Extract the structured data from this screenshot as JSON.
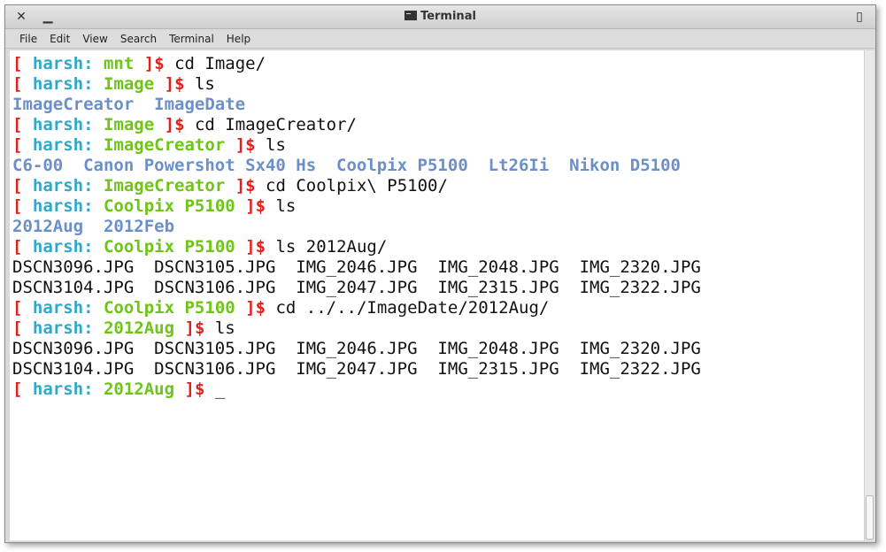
{
  "window": {
    "title": "Terminal",
    "controls": {
      "close": "✕",
      "minimize": "▁",
      "restore": "▯"
    }
  },
  "menu": [
    "File",
    "Edit",
    "View",
    "Search",
    "Terminal",
    "Help"
  ],
  "colors": {
    "bracket": "#e0211d",
    "user": "#31a8c9",
    "cwd": "#6ec417",
    "dir_listing": "#6b8fc9",
    "text": "#111111"
  },
  "terminal": {
    "lines": [
      {
        "type": "prompt",
        "user": "harsh",
        "cwd": "mnt",
        "cmd": "cd Image/"
      },
      {
        "type": "prompt",
        "user": "harsh",
        "cwd": "Image",
        "cmd": "ls"
      },
      {
        "type": "dirs",
        "text": "ImageCreator  ImageDate"
      },
      {
        "type": "prompt",
        "user": "harsh",
        "cwd": "Image",
        "cmd": "cd ImageCreator/"
      },
      {
        "type": "prompt",
        "user": "harsh",
        "cwd": "ImageCreator",
        "cmd": "ls"
      },
      {
        "type": "dirs",
        "text": "C6-00  Canon Powershot Sx40 Hs  Coolpix P5100  Lt26Ii  Nikon D5100"
      },
      {
        "type": "prompt",
        "user": "harsh",
        "cwd": "ImageCreator",
        "cmd": "cd Coolpix\\ P5100/"
      },
      {
        "type": "prompt",
        "user": "harsh",
        "cwd": "Coolpix P5100",
        "cmd": "ls"
      },
      {
        "type": "dirs",
        "text": "2012Aug  2012Feb"
      },
      {
        "type": "prompt",
        "user": "harsh",
        "cwd": "Coolpix P5100",
        "cmd": "ls 2012Aug/"
      },
      {
        "type": "out",
        "text": "DSCN3096.JPG  DSCN3105.JPG  IMG_2046.JPG  IMG_2048.JPG  IMG_2320.JPG"
      },
      {
        "type": "out",
        "text": "DSCN3104.JPG  DSCN3106.JPG  IMG_2047.JPG  IMG_2315.JPG  IMG_2322.JPG"
      },
      {
        "type": "prompt",
        "user": "harsh",
        "cwd": "Coolpix P5100",
        "cmd": "cd ../../ImageDate/2012Aug/"
      },
      {
        "type": "prompt",
        "user": "harsh",
        "cwd": "2012Aug",
        "cmd": "ls"
      },
      {
        "type": "out",
        "text": "DSCN3096.JPG  DSCN3105.JPG  IMG_2046.JPG  IMG_2048.JPG  IMG_2320.JPG"
      },
      {
        "type": "out",
        "text": "DSCN3104.JPG  DSCN3106.JPG  IMG_2047.JPG  IMG_2315.JPG  IMG_2322.JPG"
      },
      {
        "type": "prompt",
        "user": "harsh",
        "cwd": "2012Aug",
        "cmd": "_"
      }
    ]
  }
}
